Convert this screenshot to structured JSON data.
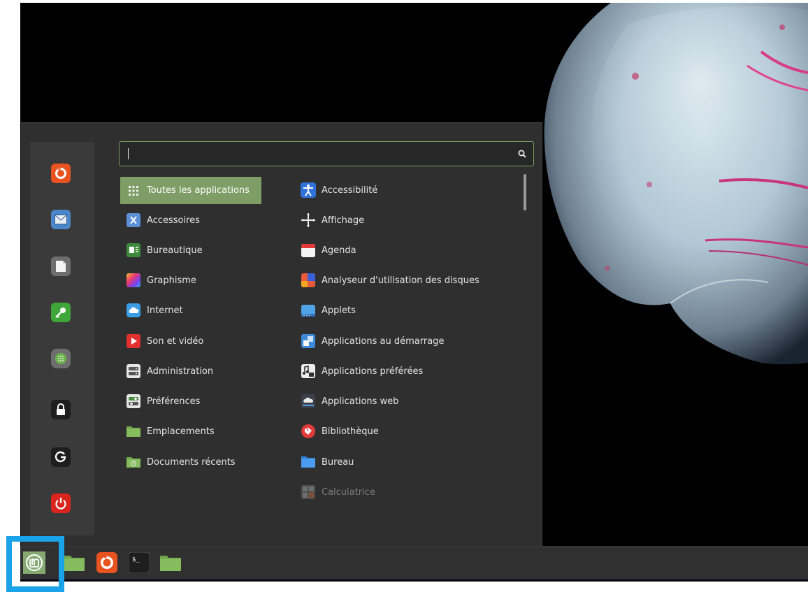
{
  "search": {
    "value": "",
    "placeholder": ""
  },
  "favorites": [
    {
      "name": "firefox-icon",
      "color": "#e8531f"
    },
    {
      "name": "mail-icon",
      "color": "#4a86c8"
    },
    {
      "name": "document-icon",
      "color": "#6e6e6e"
    },
    {
      "name": "keys-icon",
      "color": "#3fa63a"
    },
    {
      "name": "software-manager-icon",
      "color": "#5c9a48"
    },
    {
      "name": "lock-screen-icon",
      "color": "#1e1e1e"
    },
    {
      "name": "logout-icon",
      "color": "#1e1e1e"
    },
    {
      "name": "shutdown-icon",
      "color": "#d9251e"
    }
  ],
  "categories": [
    {
      "label": "Toutes les applications",
      "icon": "grid-icon",
      "selected": true
    },
    {
      "label": "Accessoires",
      "icon": "accessories-icon"
    },
    {
      "label": "Bureautique",
      "icon": "office-icon"
    },
    {
      "label": "Graphisme",
      "icon": "graphics-icon"
    },
    {
      "label": "Internet",
      "icon": "internet-icon"
    },
    {
      "label": "Son et vidéo",
      "icon": "multimedia-icon"
    },
    {
      "label": "Administration",
      "icon": "administration-icon"
    },
    {
      "label": "Préférences",
      "icon": "preferences-icon"
    },
    {
      "label": "Emplacements",
      "icon": "folder-icon"
    },
    {
      "label": "Documents récents",
      "icon": "recent-folder-icon"
    }
  ],
  "applications": [
    {
      "label": "Accessibilité",
      "icon": "accessibility-icon"
    },
    {
      "label": "Affichage",
      "icon": "display-icon"
    },
    {
      "label": "Agenda",
      "icon": "calendar-icon"
    },
    {
      "label": "Analyseur d'utilisation des disques",
      "icon": "disk-usage-icon"
    },
    {
      "label": "Applets",
      "icon": "applets-icon"
    },
    {
      "label": "Applications au démarrage",
      "icon": "startup-apps-icon"
    },
    {
      "label": "Applications préférées",
      "icon": "preferred-apps-icon"
    },
    {
      "label": "Applications web",
      "icon": "web-apps-icon"
    },
    {
      "label": "Bibliothèque",
      "icon": "library-icon"
    },
    {
      "label": "Bureau",
      "icon": "desktop-icon"
    },
    {
      "label": "Calculatrice",
      "icon": "calculator-icon",
      "dim": true
    }
  ],
  "panel": [
    {
      "name": "mint-menu-icon"
    },
    {
      "name": "files-icon"
    },
    {
      "name": "firefox-icon"
    },
    {
      "name": "terminal-icon",
      "text": "$_"
    },
    {
      "name": "folder-icon"
    }
  ],
  "colors": {
    "accent": "#7e9d67",
    "highlight": "#1aa3e8"
  }
}
